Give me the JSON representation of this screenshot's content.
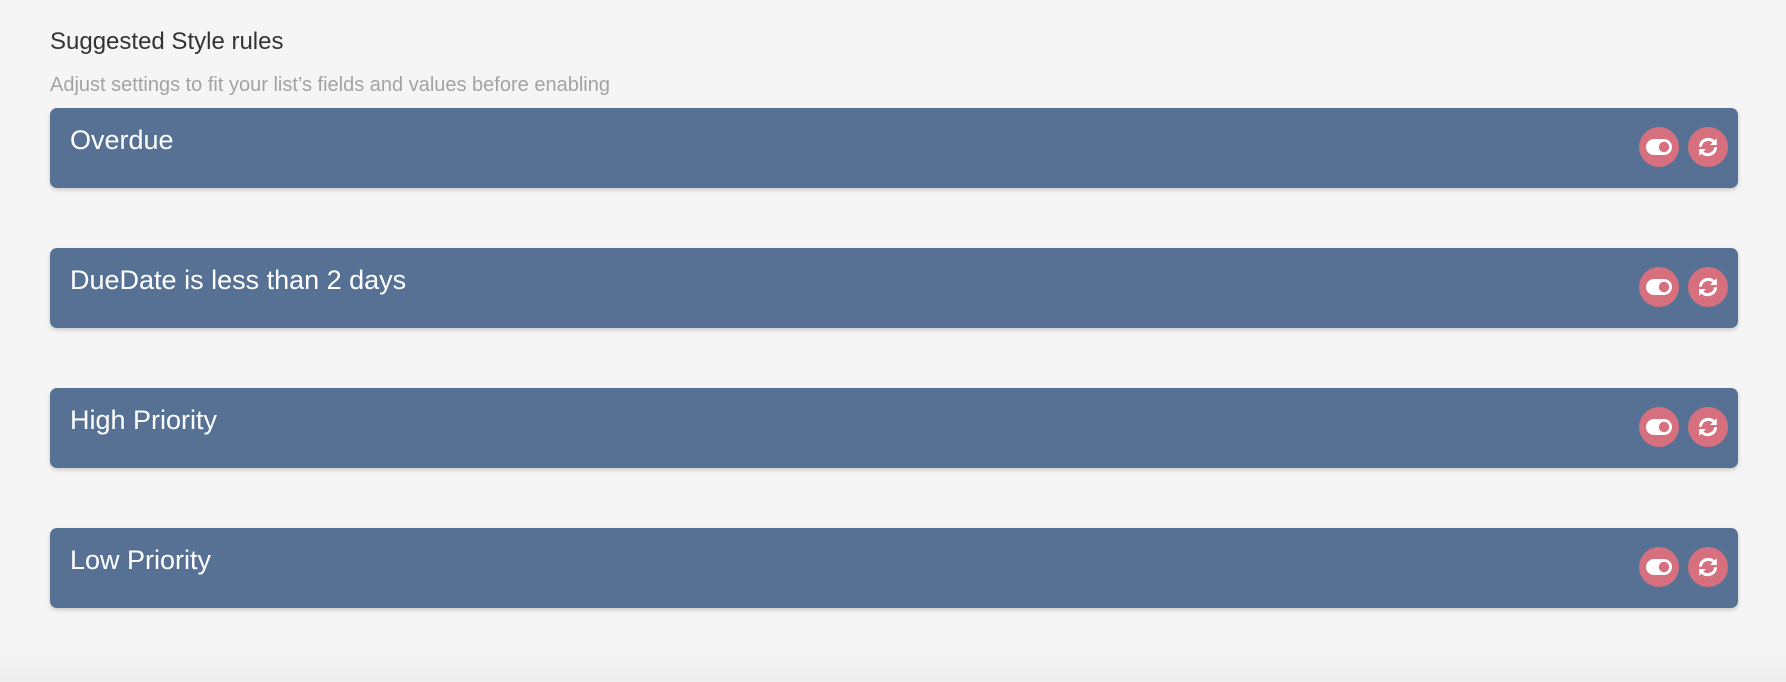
{
  "section": {
    "title": "Suggested Style rules",
    "subtitle": "Adjust settings to fit your list’s fields and values before enabling"
  },
  "rules": [
    {
      "name": "Overdue"
    },
    {
      "name": "DueDate is less than 2 days"
    },
    {
      "name": "High Priority"
    },
    {
      "name": "Low Priority"
    }
  ],
  "colors": {
    "card_background": "#577195",
    "action_button": "#d6707e",
    "page_background": "#f5f5f5"
  },
  "icons": {
    "toggle": "toggle-icon",
    "refresh": "refresh-icon"
  }
}
